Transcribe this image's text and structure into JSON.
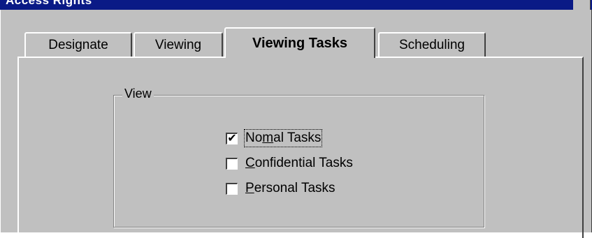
{
  "window": {
    "title": "Access Rights"
  },
  "tabs": [
    {
      "label": "Designate",
      "active": false
    },
    {
      "label": "Viewing",
      "active": false
    },
    {
      "label": "Viewing Tasks",
      "active": true
    },
    {
      "label": "Scheduling",
      "active": false
    }
  ],
  "view_group": {
    "label": "View",
    "options": [
      {
        "label": "Normal Tasks",
        "mnemonic": "m",
        "checked": true,
        "check_mark": "✔",
        "focused": true
      },
      {
        "label": "Confidential Tasks",
        "mnemonic": "C",
        "checked": false,
        "check_mark": "",
        "focused": false
      },
      {
        "label": "Personal Tasks",
        "mnemonic": "P",
        "checked": false,
        "check_mark": "",
        "focused": false
      }
    ]
  }
}
